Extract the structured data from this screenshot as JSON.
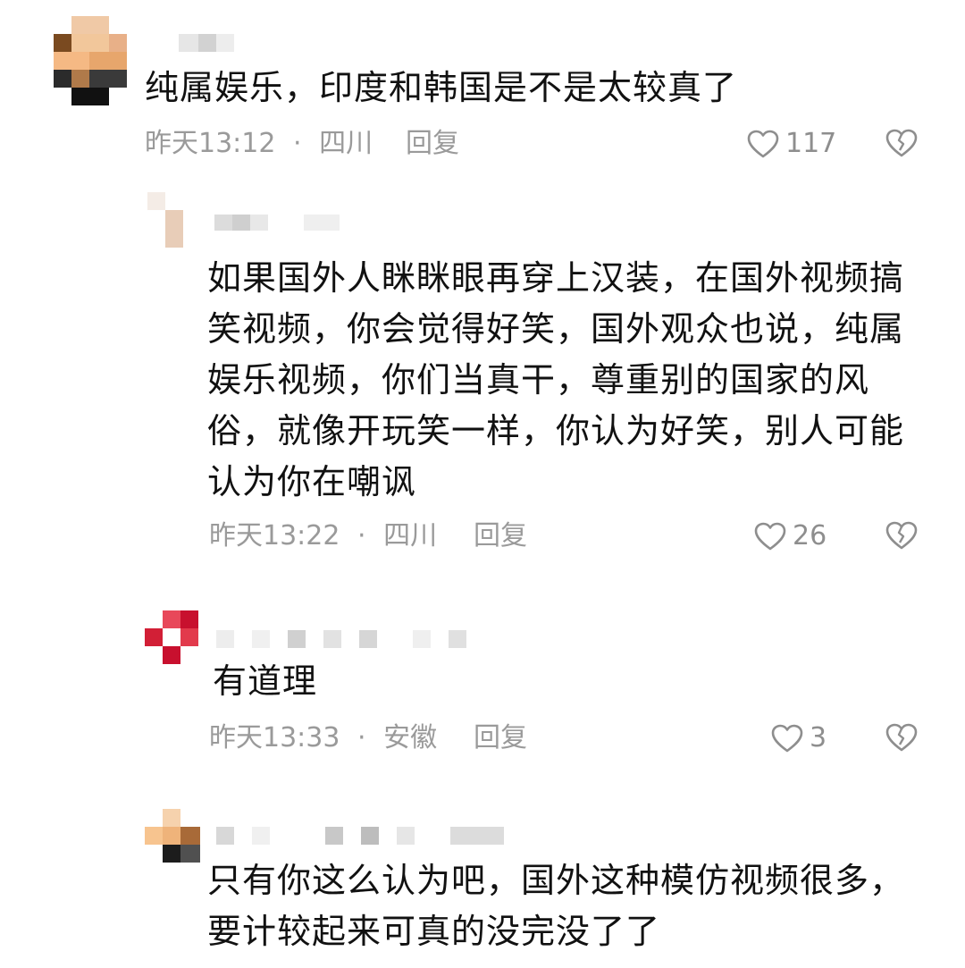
{
  "comments": [
    {
      "text": "纯属娱乐，印度和韩国是不是太较真了",
      "time": "昨天13:12",
      "location": "四川",
      "reply_label": "回复",
      "likes": "117"
    },
    {
      "text": "如果国外人眯眯眼再穿上汉装，在国外视频搞笑视频，你会觉得好笑，国外观众也说，纯属娱乐视频，你们当真干，尊重别的国家的风俗，就像开玩笑一样，你认为好笑，别人可能认为你在嘲讽",
      "time": "昨天13:22",
      "location": "四川",
      "reply_label": "回复",
      "likes": "26"
    },
    {
      "text": "有道理",
      "time": "昨天13:33",
      "location": "安徽",
      "reply_label": "回复",
      "likes": "3"
    },
    {
      "text": "只有你这么认为吧，国外这种模仿视频很多，要计较起来可真的没完没了了"
    }
  ],
  "separator": "·",
  "icons": {
    "like": "heart-outline-icon",
    "dislike": "broken-heart-icon"
  },
  "colors": {
    "text": "#111111",
    "meta": "#9a9a9a",
    "icon": "#8e8e8e"
  }
}
